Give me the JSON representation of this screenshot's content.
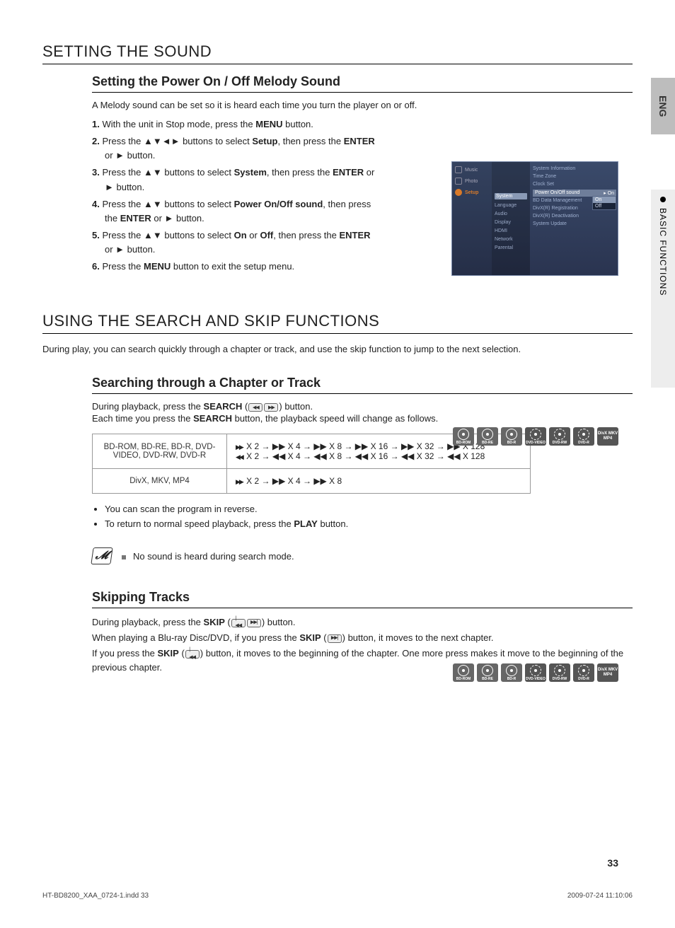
{
  "sideTabs": {
    "lang": "ENG",
    "section": "BASIC FUNCTIONS"
  },
  "sec1": {
    "title": "SETTING THE SOUND",
    "sub": {
      "title": "Setting the Power On / Off Melody Sound",
      "intro": "A Melody sound can be set so it is heard each time you turn the player on or off.",
      "steps": {
        "s1a": "With the unit in Stop mode, press the ",
        "s1b": "MENU",
        "s1c": " button.",
        "s2a": "Press the ▲▼◄► buttons to select ",
        "s2b": "Setup",
        "s2c": ", then press the ",
        "s2d": "ENTER",
        "s2e": " or ► button.",
        "s3a": "Press the ▲▼ buttons to select ",
        "s3b": "System",
        "s3c": ", then press the ",
        "s3d": "ENTER",
        "s3e": " or ► button.",
        "s4a": "Press the ▲▼ buttons to select ",
        "s4b": "Power On/Off sound",
        "s4c": ", then press the ",
        "s4d": "ENTER",
        "s4e": " or ► button.",
        "s5a": "Press the ▲▼ buttons to select ",
        "s5b": "On",
        "s5c": " or ",
        "s5d": "Off",
        "s5e": ", then press the ",
        "s5f": "ENTER",
        "s5g": " or ► button.",
        "s6a": "Press the ",
        "s6b": "MENU",
        "s6c": " button to exit the setup menu."
      }
    }
  },
  "osd": {
    "left": {
      "music": "Music",
      "photo": "Photo",
      "setup": "Setup"
    },
    "mid": [
      "System",
      "Language",
      "Audio",
      "Display",
      "HDMI",
      "Network",
      "Parental"
    ],
    "right": {
      "items": [
        "System Information",
        "Time Zone",
        "Clock Set"
      ],
      "hdr": {
        "label": "Power On/Off sound",
        "val": "On"
      },
      "below": [
        "BD Data Management",
        "DivX(R) Registration",
        "DivX(R) Deactivation",
        "System Update"
      ],
      "popup": {
        "on": "On",
        "off": "Off"
      }
    }
  },
  "sec2": {
    "title": "USING THE SEARCH AND SKIP FUNCTIONS",
    "intro": "During play, you can search quickly through a chapter or track, and use the skip function to jump to the next selection.",
    "sub1": {
      "title": "Searching through a Chapter or Track",
      "line1a": "During playback, press the ",
      "line1b": "SEARCH",
      "line1c": " (",
      "line1d": ") button.",
      "line2a": "Each time you press the ",
      "line2b": "SEARCH",
      "line2c": " button, the playback speed will change as follows.",
      "table": {
        "row1lab": "BD-ROM, BD-RE, BD-R, DVD-VIDEO, DVD-RW, DVD-R",
        "row1fwd": " X 2 → ▶▶ X 4 → ▶▶ X 8 → ▶▶ X 16 → ▶▶ X 32 → ▶▶ X 128",
        "row1rev": " X 2 → ◀◀ X 4 → ◀◀ X 8 → ◀◀ X 16 → ◀◀ X 32 → ◀◀ X 128",
        "row2lab": "DivX, MKV, MP4",
        "row2fwd": " X 2 → ▶▶ X 4 → ▶▶ X 8"
      },
      "bul1": "You can scan the program in reverse.",
      "bul2a": "To return to normal speed playback, press the ",
      "bul2b": "PLAY",
      "bul2c": " button.",
      "note": "No sound is heard during search mode."
    },
    "sub2": {
      "title": "Skipping Tracks",
      "p1a": "During playback, press the ",
      "p1b": "SKIP",
      "p1c": " (",
      "p1d": ") button.",
      "p2a": "When playing a Blu-ray Disc/DVD, if you press the ",
      "p2b": "SKIP",
      "p2c": " (",
      "p2d": ") button, it moves to the next chapter.",
      "p3a": "If you press the ",
      "p3b": "SKIP",
      "p3c": " (",
      "p3d": ") button, it moves to the beginning of the chapter. One more press makes it move to the beginning of the previous chapter."
    }
  },
  "discs": [
    "BD-ROM",
    "BD-RE",
    "BD-R",
    "DVD-VIDEO",
    "DVD-RW",
    "DVD-R"
  ],
  "fileDisc": "DivX\nMKV\nMP4",
  "pageNum": "33",
  "footer": {
    "left": "HT-BD8200_XAA_0724-1.indd   33",
    "right": "2009-07-24   11:10:06"
  }
}
